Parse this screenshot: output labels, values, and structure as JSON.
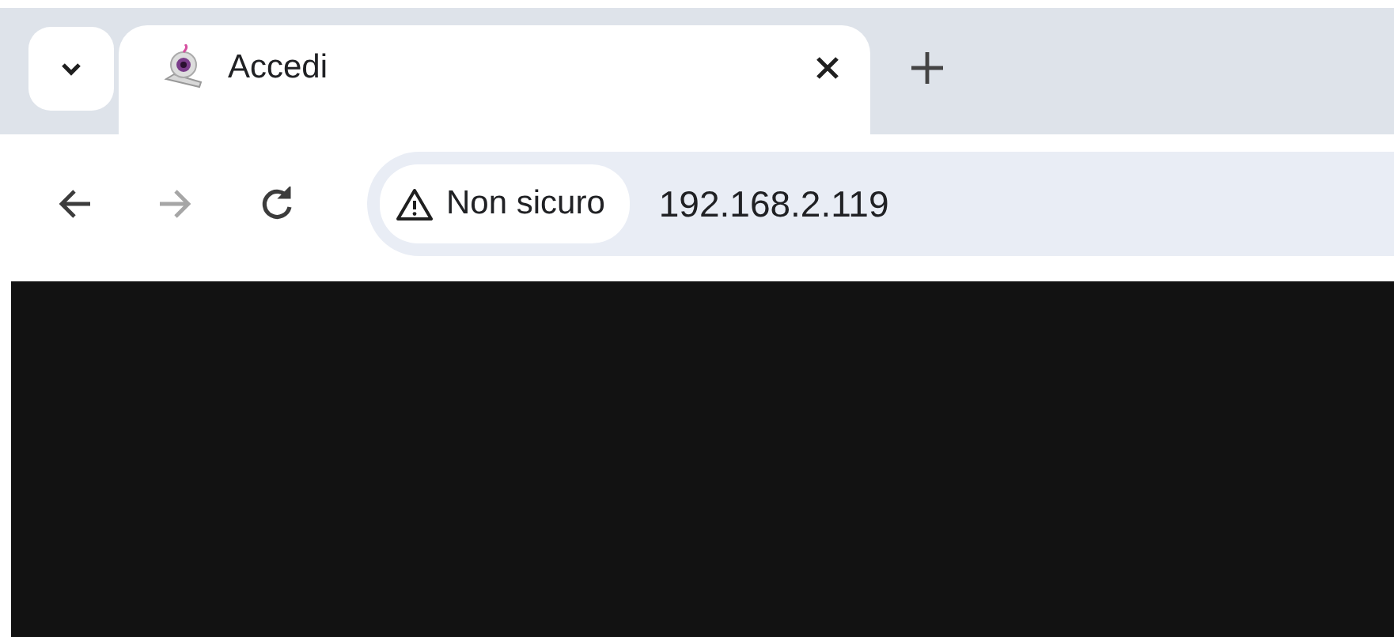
{
  "tabs": [
    {
      "title": "Accedi",
      "selected": true
    }
  ],
  "toolbar": {
    "buttons": [
      {
        "kind": "back",
        "disabled": false
      },
      {
        "kind": "forward",
        "disabled": true
      },
      {
        "kind": "reload",
        "disabled": false
      }
    ]
  },
  "address_bar": {
    "security_chip": "Non sicuro",
    "url": "192.168.2.119"
  }
}
